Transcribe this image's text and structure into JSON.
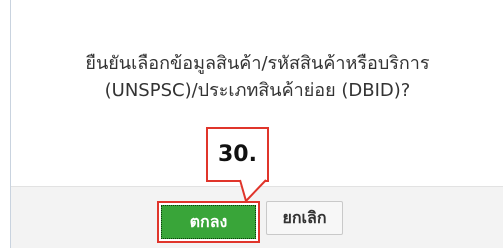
{
  "dialog": {
    "message_line1": "ยืนยันเลือกข้อมูลสินค้า/รหัสสินค้าหรือบริการ",
    "message_line2": "(UNSPSC)/ประเภทสินค้าย่อย (DBID)?",
    "ok_label": "ตกลง",
    "cancel_label": "ยกเลิก"
  },
  "annotation": {
    "step_label": "30.",
    "highlight_color": "#e0352b"
  },
  "colors": {
    "ok_button": "#39a539",
    "footer_bg": "#f3f3f3"
  }
}
